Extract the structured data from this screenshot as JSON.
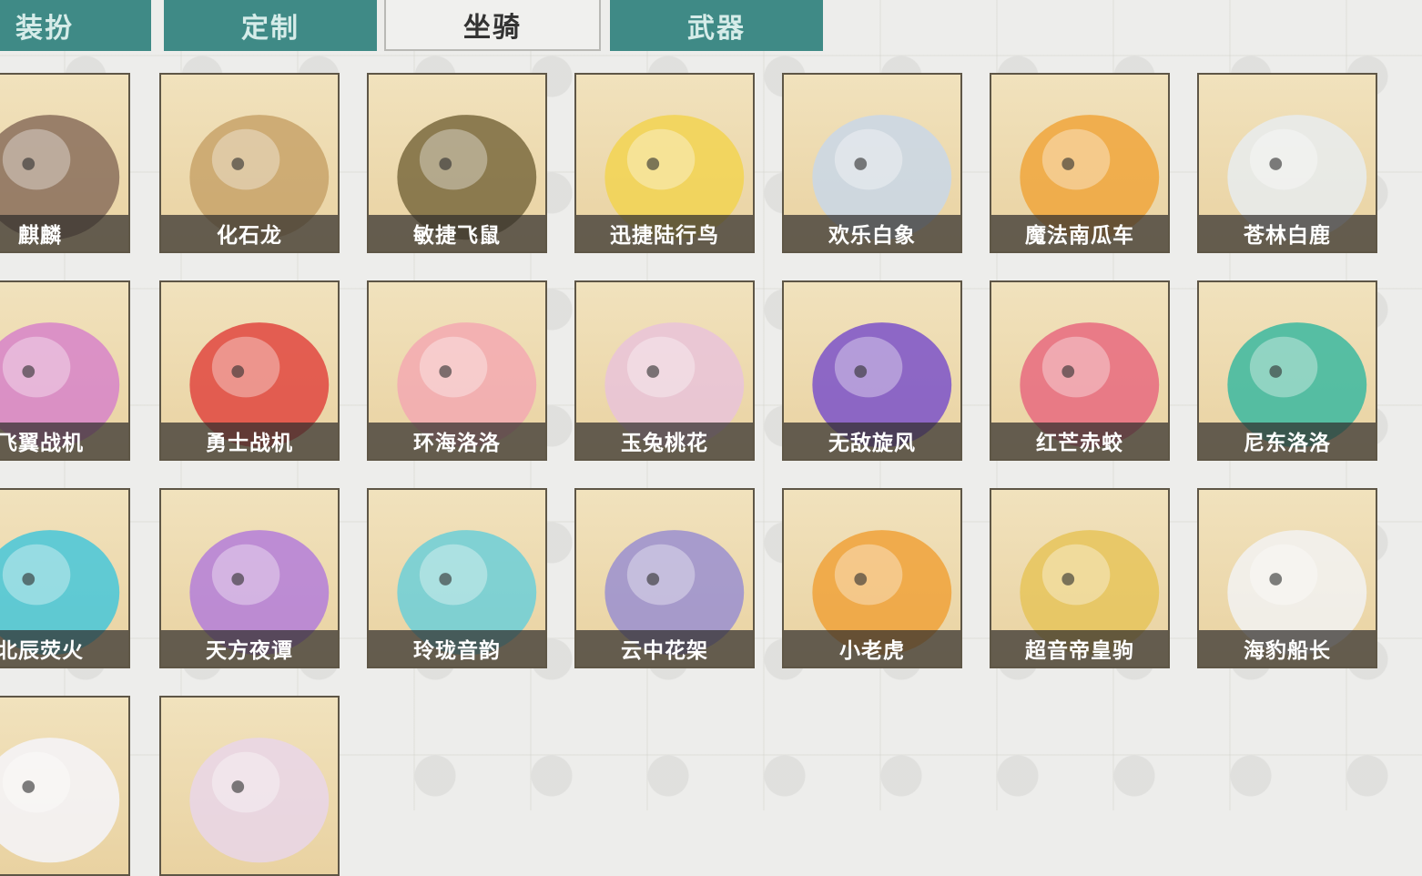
{
  "tabs": [
    {
      "label": "装扮",
      "active": false
    },
    {
      "label": "定制",
      "active": false
    },
    {
      "label": "坐骑",
      "active": true
    },
    {
      "label": "武器",
      "active": false
    }
  ],
  "mounts": [
    {
      "name": "麒麟",
      "icon": "qilin-mount-icon",
      "color": "#8a6f5c"
    },
    {
      "name": "化石龙",
      "icon": "fossil-dragon-mount-icon",
      "color": "#c8a36a"
    },
    {
      "name": "敏捷飞鼠",
      "icon": "flying-squirrel-mount-icon",
      "color": "#7a6a3e"
    },
    {
      "name": "迅捷陆行鸟",
      "icon": "chocobo-mount-icon",
      "color": "#f2d451"
    },
    {
      "name": "欢乐白象",
      "icon": "elephant-mount-icon",
      "color": "#c9d7e8"
    },
    {
      "name": "魔法南瓜车",
      "icon": "pumpkin-carriage-mount-icon",
      "color": "#f0a63c"
    },
    {
      "name": "苍林白鹿",
      "icon": "white-deer-mount-icon",
      "color": "#e8ecee"
    },
    {
      "name": "飞翼战机",
      "icon": "wing-fighter-mount-icon",
      "color": "#d784c9"
    },
    {
      "name": "勇士战机",
      "icon": "warrior-fighter-mount-icon",
      "color": "#e0463f"
    },
    {
      "name": "环海洛洛",
      "icon": "sea-lolo-mount-icon",
      "color": "#f3a9b1"
    },
    {
      "name": "玉兔桃花",
      "icon": "jade-rabbit-mount-icon",
      "color": "#e9c3d9"
    },
    {
      "name": "无敌旋风",
      "icon": "cyclone-car-mount-icon",
      "color": "#7b52c9"
    },
    {
      "name": "红芒赤蛟",
      "icon": "red-jiao-mount-icon",
      "color": "#e86a7f"
    },
    {
      "name": "尼东洛洛",
      "icon": "nidong-lolo-mount-icon",
      "color": "#3bb9a0"
    },
    {
      "name": "北辰荧火",
      "icon": "beichen-firefly-mount-icon",
      "color": "#46c7d9"
    },
    {
      "name": "天方夜谭",
      "icon": "magic-carpet-mount-icon",
      "color": "#b47ed9"
    },
    {
      "name": "玲珑音韵",
      "icon": "palanquin-mount-icon",
      "color": "#6ccfd8"
    },
    {
      "name": "云中花架",
      "icon": "flower-swing-mount-icon",
      "color": "#9a8fd0"
    },
    {
      "name": "小老虎",
      "icon": "tiger-mount-icon",
      "color": "#f0a23a"
    },
    {
      "name": "超音帝皇驹",
      "icon": "emperor-steed-mount-icon",
      "color": "#e6c45a"
    },
    {
      "name": "海豹船长",
      "icon": "seal-captain-mount-icon",
      "color": "#f2f2f2"
    },
    {
      "name": "",
      "icon": "white-bird-mount-icon",
      "color": "#f5f5fa"
    },
    {
      "name": "",
      "icon": "paper-crane-mount-icon",
      "color": "#e9d6e9"
    }
  ]
}
